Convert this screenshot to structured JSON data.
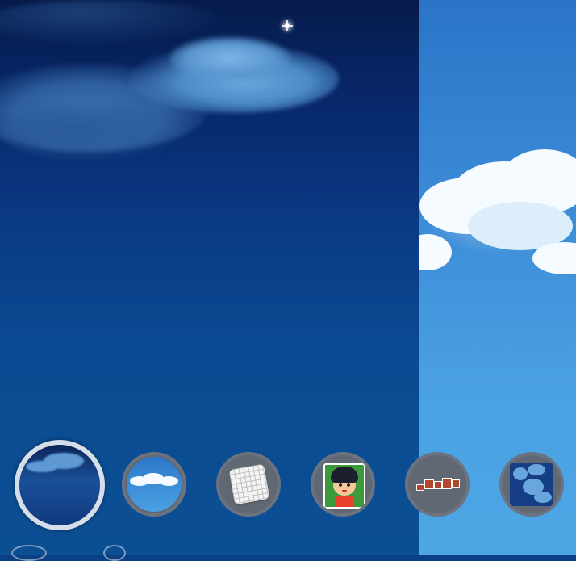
{
  "wallpaper_picker": {
    "panes": [
      "night-sky-wallpaper",
      "day-sky-wallpaper"
    ],
    "thumbnails": [
      {
        "name": "night-sky-clouds",
        "selected": true
      },
      {
        "name": "day-sky-clouds",
        "selected": false
      },
      {
        "name": "grid-paper",
        "selected": false
      },
      {
        "name": "cartoon-character",
        "selected": false
      },
      {
        "name": "skeleton-figures",
        "selected": false
      },
      {
        "name": "blue-clouds-pattern",
        "selected": false
      }
    ]
  },
  "colors": {
    "night_top": "#061b4a",
    "night_bottom": "#0b4f93",
    "day_top": "#2b74c8",
    "day_bottom": "#4ea6e5",
    "selected_ring": "#d6dfe9",
    "thumb_ring": "#6b7380"
  }
}
